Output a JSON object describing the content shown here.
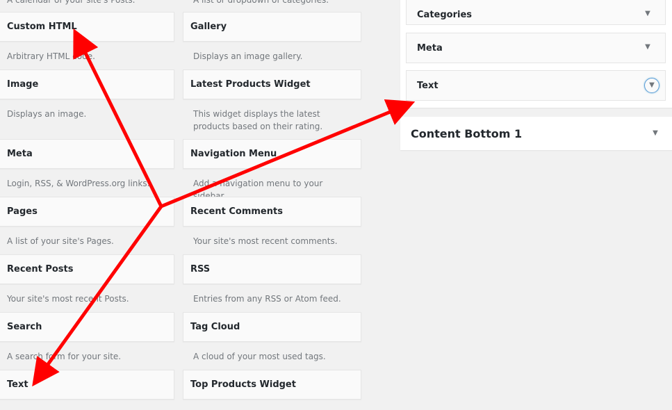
{
  "available_widgets": {
    "partial_descriptions": [
      "A calendar of your site's Posts.",
      "A list or dropdown of categories."
    ],
    "items": [
      {
        "title": "Custom HTML",
        "description": "Arbitrary HTML code."
      },
      {
        "title": "Gallery",
        "description": "Displays an image gallery."
      },
      {
        "title": "Image",
        "description": "Displays an image."
      },
      {
        "title": "Latest Products Widget",
        "description": "This widget displays the latest products based on their rating."
      },
      {
        "title": "Meta",
        "description": "Login, RSS, & WordPress.org links."
      },
      {
        "title": "Navigation Menu",
        "description": "Add a navigation menu to your sidebar."
      },
      {
        "title": "Pages",
        "description": "A list of your site's Pages."
      },
      {
        "title": "Recent Comments",
        "description": "Your site's most recent comments."
      },
      {
        "title": "Recent Posts",
        "description": "Your site's most recent Posts."
      },
      {
        "title": "RSS",
        "description": "Entries from any RSS or Atom feed."
      },
      {
        "title": "Search",
        "description": "A search form for your site."
      },
      {
        "title": "Tag Cloud",
        "description": "A cloud of your most used tags."
      },
      {
        "title": "Text",
        "description": ""
      },
      {
        "title": "Top Products Widget",
        "description": ""
      }
    ]
  },
  "sidebar_area": {
    "widgets": [
      {
        "title": "Categories",
        "icon": "triangle-down-icon"
      },
      {
        "title": "Meta",
        "icon": "triangle-down-icon"
      },
      {
        "title": "Text",
        "icon": "triangle-down-icon",
        "focused": true
      }
    ]
  },
  "content_bottom": {
    "title": "Content Bottom 1",
    "icon": "triangle-down-icon"
  },
  "colors": {
    "annotation_arrow": "#ff0000",
    "focus_ring": "#5b9dd9",
    "background": "#f1f1f1"
  }
}
